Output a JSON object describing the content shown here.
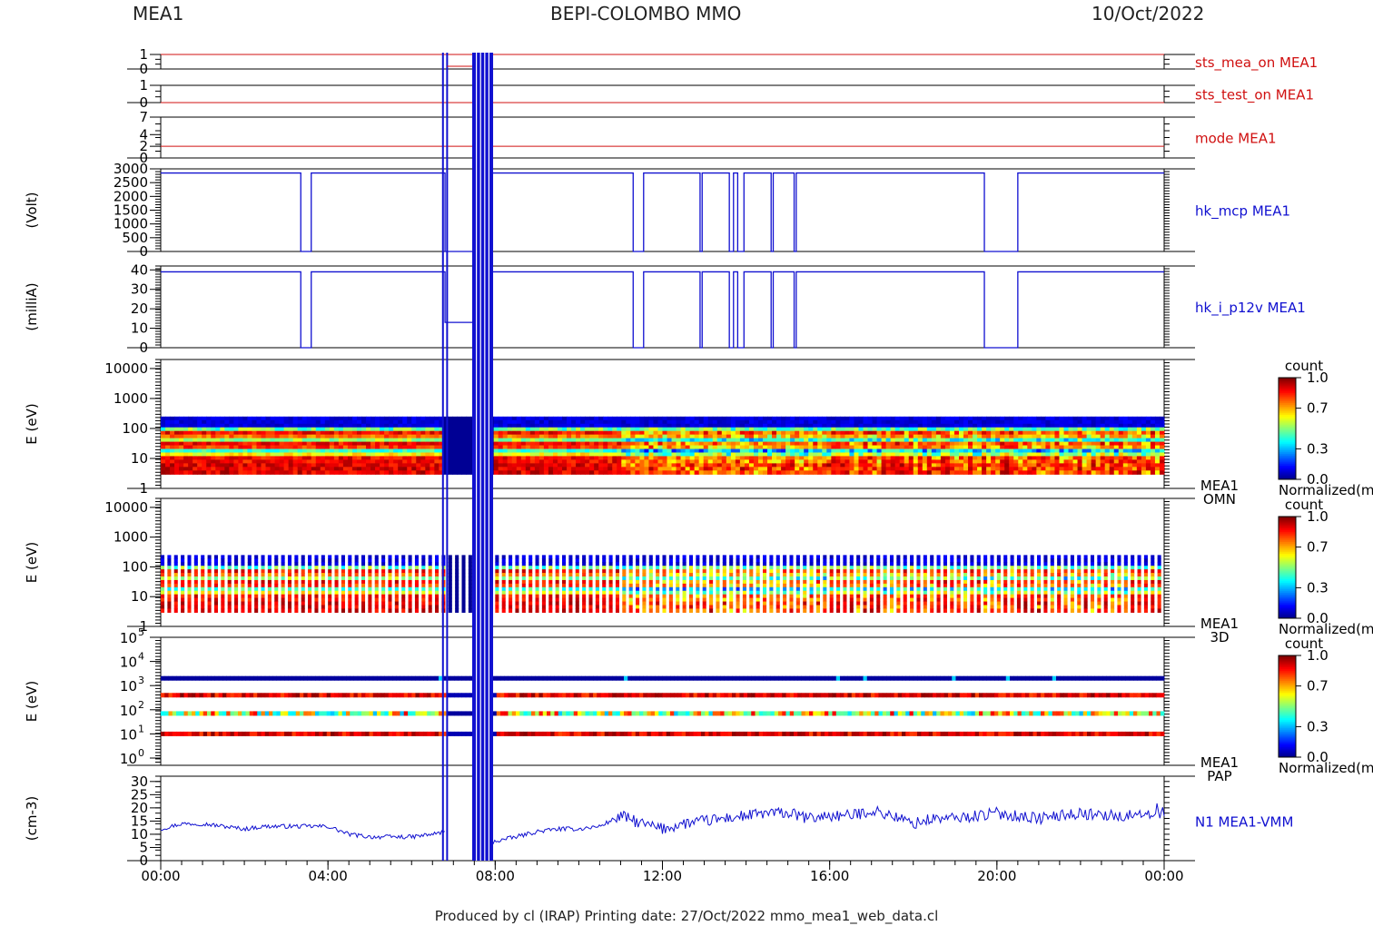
{
  "header": {
    "left": "MEA1",
    "center": "BEPI-COLOMBO MMO",
    "right": "10/Oct/2022"
  },
  "footer": "Produced by cl (IRAP)    Printing date: 27/Oct/2022    mmo_mea1_web_data.cl",
  "x_axis": {
    "ticks": [
      "00:00",
      "04:00",
      "08:00",
      "12:00",
      "16:00",
      "20:00",
      "00:00"
    ],
    "range_hours": [
      0,
      24
    ]
  },
  "colors": {
    "status": "#d01010",
    "data": "#1010d0",
    "axis": "#000000"
  },
  "colorbar": {
    "title": "count",
    "ticks": [
      "1.0",
      "0.7",
      "0.3",
      "0.0"
    ],
    "caption": "Normalized(m"
  },
  "chart_data": [
    {
      "id": "sts_mea_on",
      "type": "line",
      "label": "sts_mea_on MEA1",
      "yticks": [
        "1",
        "0"
      ],
      "ylim": [
        0,
        1
      ],
      "series": [
        {
          "name": "sts_mea_on MEA1",
          "x_hours": [
            0,
            24
          ],
          "y": [
            1,
            1
          ]
        }
      ]
    },
    {
      "id": "sts_test_on",
      "type": "line",
      "label": "sts_test_on MEA1",
      "yticks": [
        "1",
        "0"
      ],
      "ylim": [
        0,
        1
      ],
      "series": [
        {
          "name": "sts_test_on MEA1",
          "x_hours": [
            0,
            24
          ],
          "y": [
            0,
            0
          ]
        }
      ]
    },
    {
      "id": "mode",
      "type": "line",
      "label": "mode MEA1",
      "yticks": [
        "7",
        "4",
        "2",
        "0"
      ],
      "ylim": [
        0,
        7
      ],
      "series": [
        {
          "name": "mode MEA1",
          "x_hours": [
            0,
            24
          ],
          "y": [
            2,
            2
          ]
        }
      ]
    },
    {
      "id": "hk_mcp",
      "type": "line",
      "label": "hk_mcp MEA1",
      "ylabel": "(Volt)",
      "yticks": [
        "3000",
        "2500",
        "2000",
        "1500",
        "1000",
        "500",
        "0"
      ],
      "ylim": [
        0,
        3000
      ],
      "level": 2850,
      "dropouts_hours": [
        [
          3.35,
          3.6
        ],
        [
          11.3,
          11.55
        ],
        [
          12.9,
          12.95
        ],
        [
          13.6,
          13.7
        ],
        [
          13.8,
          13.95
        ],
        [
          14.6,
          14.65
        ],
        [
          15.15,
          15.2
        ],
        [
          19.7,
          20.5
        ]
      ],
      "gap_hours": [
        6.8,
        7.9
      ]
    },
    {
      "id": "hk_i_p12v",
      "type": "line",
      "label": "hk_i_p12v MEA1",
      "ylabel": "(milliA)",
      "yticks": [
        "40",
        "30",
        "20",
        "10",
        "0"
      ],
      "ylim": [
        0,
        42
      ],
      "level": 39,
      "dropouts_hours": [
        [
          3.35,
          3.6
        ],
        [
          11.3,
          11.55
        ],
        [
          12.9,
          12.95
        ],
        [
          13.6,
          13.7
        ],
        [
          13.8,
          13.95
        ],
        [
          14.6,
          14.65
        ],
        [
          15.15,
          15.2
        ],
        [
          19.7,
          20.5
        ]
      ],
      "gap_hours": [
        6.8,
        7.9
      ],
      "gap_level": 13
    },
    {
      "id": "omn",
      "type": "heatmap",
      "label": [
        "MEA1",
        "OMN"
      ],
      "ylabel": "E (eV)",
      "yticks": [
        "10000",
        "1000",
        "100",
        "10",
        "1"
      ],
      "yscale": "log",
      "ylim": [
        1,
        20000
      ],
      "energy_range": [
        3,
        250
      ]
    },
    {
      "id": "3d",
      "type": "heatmap",
      "label": [
        "MEA1",
        "3D"
      ],
      "ylabel": "E (eV)",
      "yticks": [
        "10000",
        "1000",
        "100",
        "10",
        "1"
      ],
      "yscale": "log",
      "ylim": [
        1,
        20000
      ],
      "energy_range": [
        3,
        250
      ]
    },
    {
      "id": "pap",
      "type": "heatmap",
      "label": [
        "MEA1",
        "PAP"
      ],
      "ylabel": "E (eV)",
      "yticks": [
        "10^5",
        "10^4",
        "10^3",
        "10^2",
        "10^1",
        "10^0"
      ],
      "yscale": "log",
      "ylim": [
        0.5,
        100000
      ],
      "bands_eV": [
        2000,
        400,
        70,
        10
      ]
    },
    {
      "id": "n1",
      "type": "line",
      "label": "N1 MEA1-VMM",
      "ylabel": "(cm-3)",
      "yticks": [
        "30",
        "25",
        "20",
        "15",
        "10",
        "5",
        "0"
      ],
      "ylim": [
        0,
        32
      ],
      "series": [
        {
          "name": "N1 MEA1-VMM",
          "x_hours": [
            0,
            0.5,
            1,
            1.5,
            2,
            2.5,
            3,
            3.5,
            4,
            4.5,
            5,
            5.5,
            6,
            6.5,
            6.8,
            7.9,
            8.5,
            9,
            9.5,
            10,
            10.5,
            11,
            11.5,
            12,
            12.5,
            13,
            13.5,
            14,
            14.5,
            15,
            15.5,
            16,
            16.5,
            17,
            17.5,
            18,
            18.5,
            19,
            19.5,
            20,
            20.5,
            21,
            21.5,
            22,
            22.5,
            23,
            23.5,
            24
          ],
          "y": [
            12,
            14,
            14,
            13,
            12,
            13,
            13,
            13,
            13,
            10,
            9,
            9,
            9,
            10,
            11,
            7,
            9,
            11,
            12,
            12,
            13,
            17,
            14,
            12,
            14,
            15,
            16,
            17,
            18,
            18,
            16,
            17,
            17,
            19,
            17,
            14,
            16,
            16,
            17,
            18,
            17,
            16,
            17,
            18,
            17,
            17,
            18,
            18
          ]
        }
      ]
    }
  ]
}
